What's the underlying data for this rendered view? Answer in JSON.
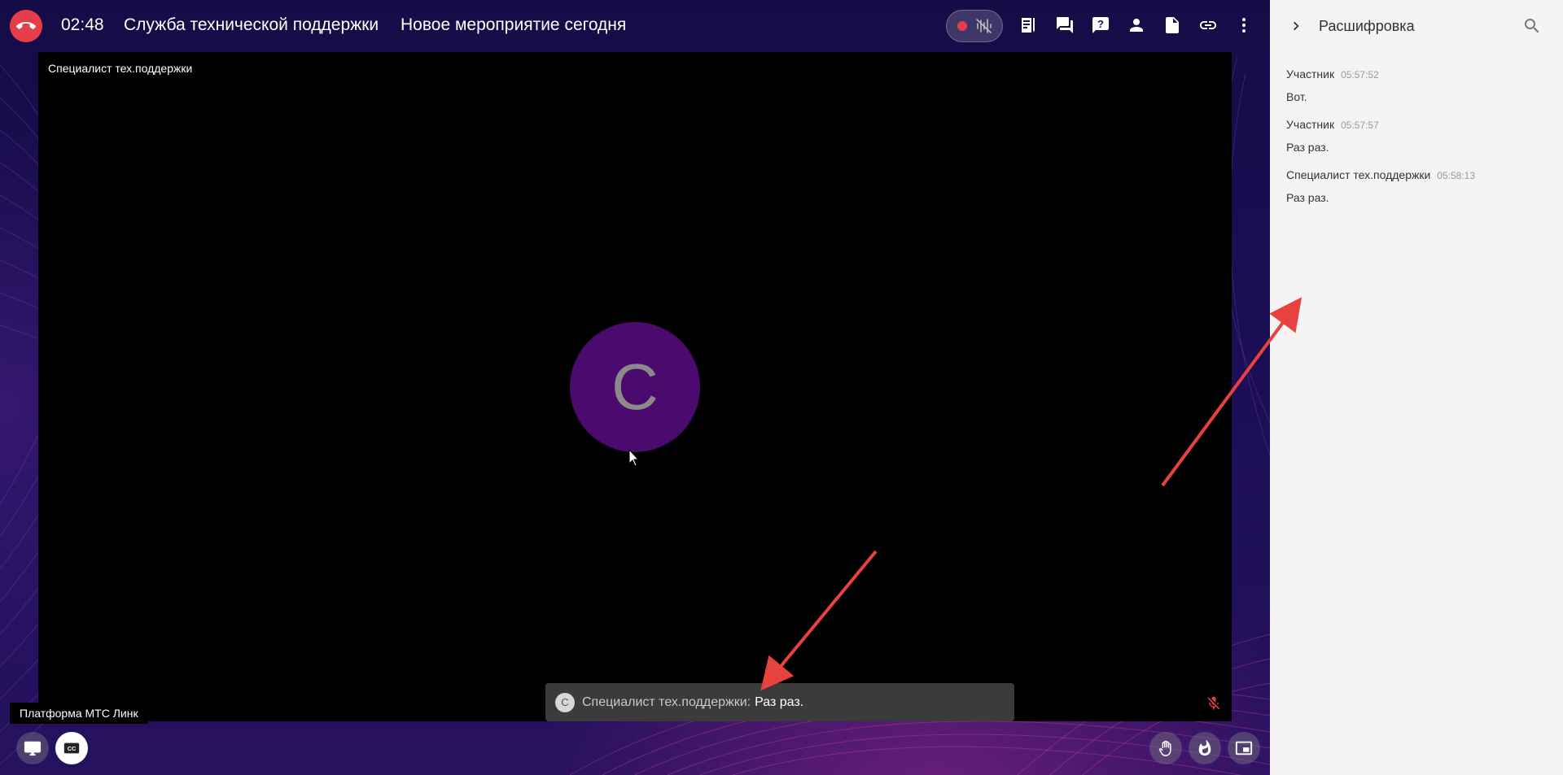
{
  "header": {
    "timer": "02:48",
    "title": "Служба технической поддержки",
    "event": "Новое мероприятие сегодня"
  },
  "toolbar": {
    "icons": [
      "record-icon",
      "noise-icon",
      "notes-icon",
      "chat-icon",
      "question-icon",
      "participants-icon",
      "document-icon",
      "link-icon",
      "more-icon"
    ]
  },
  "video": {
    "participant_name": "Специалист тех.поддержки",
    "avatar_letter": "С"
  },
  "caption": {
    "avatar_letter": "С",
    "speaker": "Специалист тех.поддержки:",
    "text": "Раз раз."
  },
  "footer": {
    "platform_label": "Платформа МТС Линк"
  },
  "transcript": {
    "title": "Расшифровка",
    "entries": [
      {
        "author": "Участник",
        "time": "05:57:52",
        "text": "Вот."
      },
      {
        "author": "Участник",
        "time": "05:57:57",
        "text": "Раз раз."
      },
      {
        "author": "Специалист тех.поддержки",
        "time": "05:58:13",
        "text": "Раз раз."
      }
    ]
  },
  "colors": {
    "hangup": "#e53e4a",
    "avatar": "#4b0a6e",
    "annotation_arrow": "#e8423f",
    "panel_bg": "#f4f4f4"
  }
}
